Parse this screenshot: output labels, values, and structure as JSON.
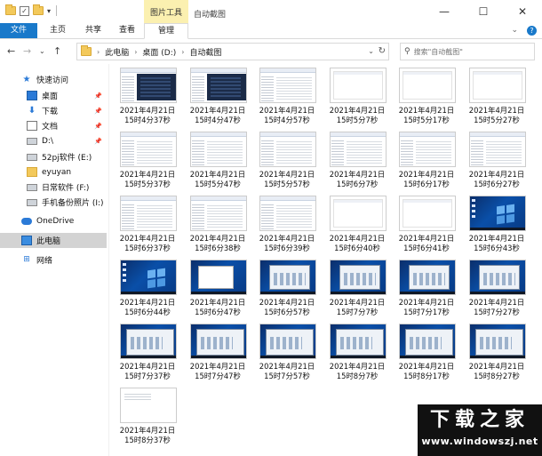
{
  "window": {
    "contextual_tab": "图片工具",
    "title": "自动截图",
    "controls": {
      "minimize": "—",
      "maximize": "☐",
      "close": "✕"
    }
  },
  "ribbon": {
    "tabs": [
      "文件",
      "主页",
      "共享",
      "查看",
      "管理"
    ],
    "expand": "⌄",
    "help": "?"
  },
  "nav": {
    "back": "←",
    "forward": "→",
    "history": "⌄",
    "up": "↑"
  },
  "address": {
    "crumbs": [
      "此电脑",
      "桌面 (D:)",
      "自动截图"
    ],
    "refresh": "↻"
  },
  "search": {
    "placeholder": "搜索\"自动截图\""
  },
  "sidebar": {
    "quick_access": "快速访问",
    "items": [
      "桌面",
      "下载",
      "文档",
      "D:\\",
      "52pj软件 (E:)",
      "eyuyan",
      "日常软件 (F:)",
      "手机备份照片 (I:)"
    ],
    "onedrive": "OneDrive",
    "this_pc": "此电脑",
    "network": "网络"
  },
  "files": [
    {
      "name": "2021年4月21日\n15时4分37秒",
      "thumb": "explorer-dark"
    },
    {
      "name": "2021年4月21日\n15时4分47秒",
      "thumb": "explorer-dark"
    },
    {
      "name": "2021年4月21日\n15时4分57秒",
      "thumb": "explorer"
    },
    {
      "name": "2021年4月21日\n15时5分7秒",
      "thumb": "blank"
    },
    {
      "name": "2021年4月21日\n15时5分17秒",
      "thumb": "blank"
    },
    {
      "name": "2021年4月21日\n15时5分27秒",
      "thumb": "blank"
    },
    {
      "name": "2021年4月21日\n15时5分37秒",
      "thumb": "explorer"
    },
    {
      "name": "2021年4月21日\n15时5分47秒",
      "thumb": "explorer"
    },
    {
      "name": "2021年4月21日\n15时5分57秒",
      "thumb": "explorer"
    },
    {
      "name": "2021年4月21日\n15时6分7秒",
      "thumb": "explorer"
    },
    {
      "name": "2021年4月21日\n15时6分17秒",
      "thumb": "explorer"
    },
    {
      "name": "2021年4月21日\n15时6分27秒",
      "thumb": "explorer"
    },
    {
      "name": "2021年4月21日\n15时6分37秒",
      "thumb": "explorer"
    },
    {
      "name": "2021年4月21日\n15时6分38秒",
      "thumb": "explorer"
    },
    {
      "name": "2021年4月21日\n15时6分39秒",
      "thumb": "explorer"
    },
    {
      "name": "2021年4月21日\n15时6分40秒",
      "thumb": "blank"
    },
    {
      "name": "2021年4月21日\n15时6分41秒",
      "thumb": "blank"
    },
    {
      "name": "2021年4月21日\n15时6分43秒",
      "thumb": "win"
    },
    {
      "name": "2021年4月21日\n15时6分44秒",
      "thumb": "win"
    },
    {
      "name": "2021年4月21日\n15时6分47秒",
      "thumb": "winwhite"
    },
    {
      "name": "2021年4月21日\n15时6分57秒",
      "thumb": "windlg"
    },
    {
      "name": "2021年4月21日\n15时7分7秒",
      "thumb": "windlg"
    },
    {
      "name": "2021年4月21日\n15时7分17秒",
      "thumb": "windlg"
    },
    {
      "name": "2021年4月21日\n15时7分27秒",
      "thumb": "windlg"
    },
    {
      "name": "2021年4月21日\n15时7分37秒",
      "thumb": "windlg-big"
    },
    {
      "name": "2021年4月21日\n15时7分47秒",
      "thumb": "windlg-big"
    },
    {
      "name": "2021年4月21日\n15时7分57秒",
      "thumb": "windlg-big"
    },
    {
      "name": "2021年4月21日\n15时8分7秒",
      "thumb": "windlg-big"
    },
    {
      "name": "2021年4月21日\n15时8分17秒",
      "thumb": "windlg-big"
    },
    {
      "name": "2021年4月21日\n15时8分27秒",
      "thumb": "windlg-big"
    },
    {
      "name": "2021年4月21日\n15时8分37秒",
      "thumb": "docwhite"
    }
  ],
  "watermark": {
    "top": "下载之家",
    "bottom": "www.windowszj.net"
  }
}
